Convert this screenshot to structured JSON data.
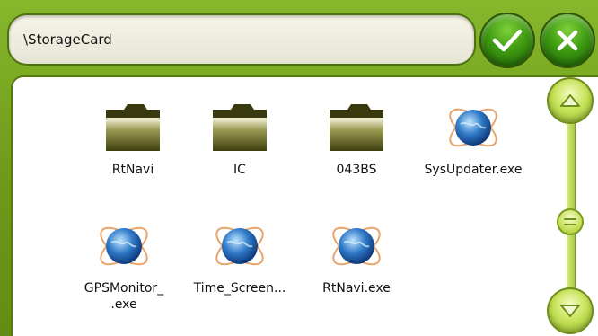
{
  "path_bar": {
    "path": "\\StorageCard"
  },
  "toolbar": {
    "ok_icon": "checkmark-icon",
    "close_icon": "close-icon"
  },
  "files": [
    {
      "name": "RtNavi",
      "type": "folder",
      "icon": "folder-icon"
    },
    {
      "name": "IC",
      "type": "folder",
      "icon": "folder-icon"
    },
    {
      "name": "043BS",
      "type": "folder",
      "icon": "folder-icon"
    },
    {
      "name": "SysUpdater.exe",
      "type": "exe",
      "icon": "globe-app-icon"
    },
    {
      "name": "GPSMonitor_\n.exe",
      "type": "exe",
      "icon": "globe-app-icon"
    },
    {
      "name": "Time_Screen...",
      "type": "exe",
      "icon": "globe-app-icon"
    },
    {
      "name": "RtNavi.exe",
      "type": "exe",
      "icon": "globe-app-icon"
    }
  ],
  "scrollbar": {
    "up_icon": "arrow-up-icon",
    "down_icon": "arrow-down-icon",
    "thumb_icon": "grip-icon",
    "position": 0.5
  },
  "colors": {
    "frame": "#6f9a1c",
    "button": "#3f9a12",
    "scroll": "#c8e35a"
  }
}
